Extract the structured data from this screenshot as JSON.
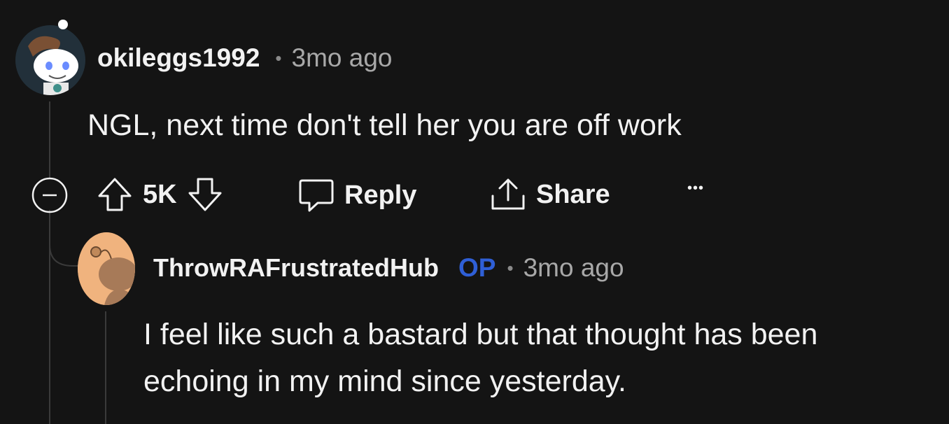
{
  "comment": {
    "username": "okileggs1992",
    "time": "3mo ago",
    "body": "NGL, next time don't tell her you are off work",
    "votes": "5K",
    "reply_label": "Reply",
    "share_label": "Share",
    "more_label": "•••",
    "dot": "•"
  },
  "reply": {
    "username": "ThrowRAFrustratedHub",
    "op_badge": "OP",
    "time": "3mo ago",
    "body_line1": "I feel like such a bastard but that thought has been",
    "body_line2": "echoing in my mind since yesterday.",
    "dot": "•"
  },
  "colors": {
    "background": "#141414",
    "op_badge": "#2f5fd6",
    "muted": "#a8a8a8"
  }
}
